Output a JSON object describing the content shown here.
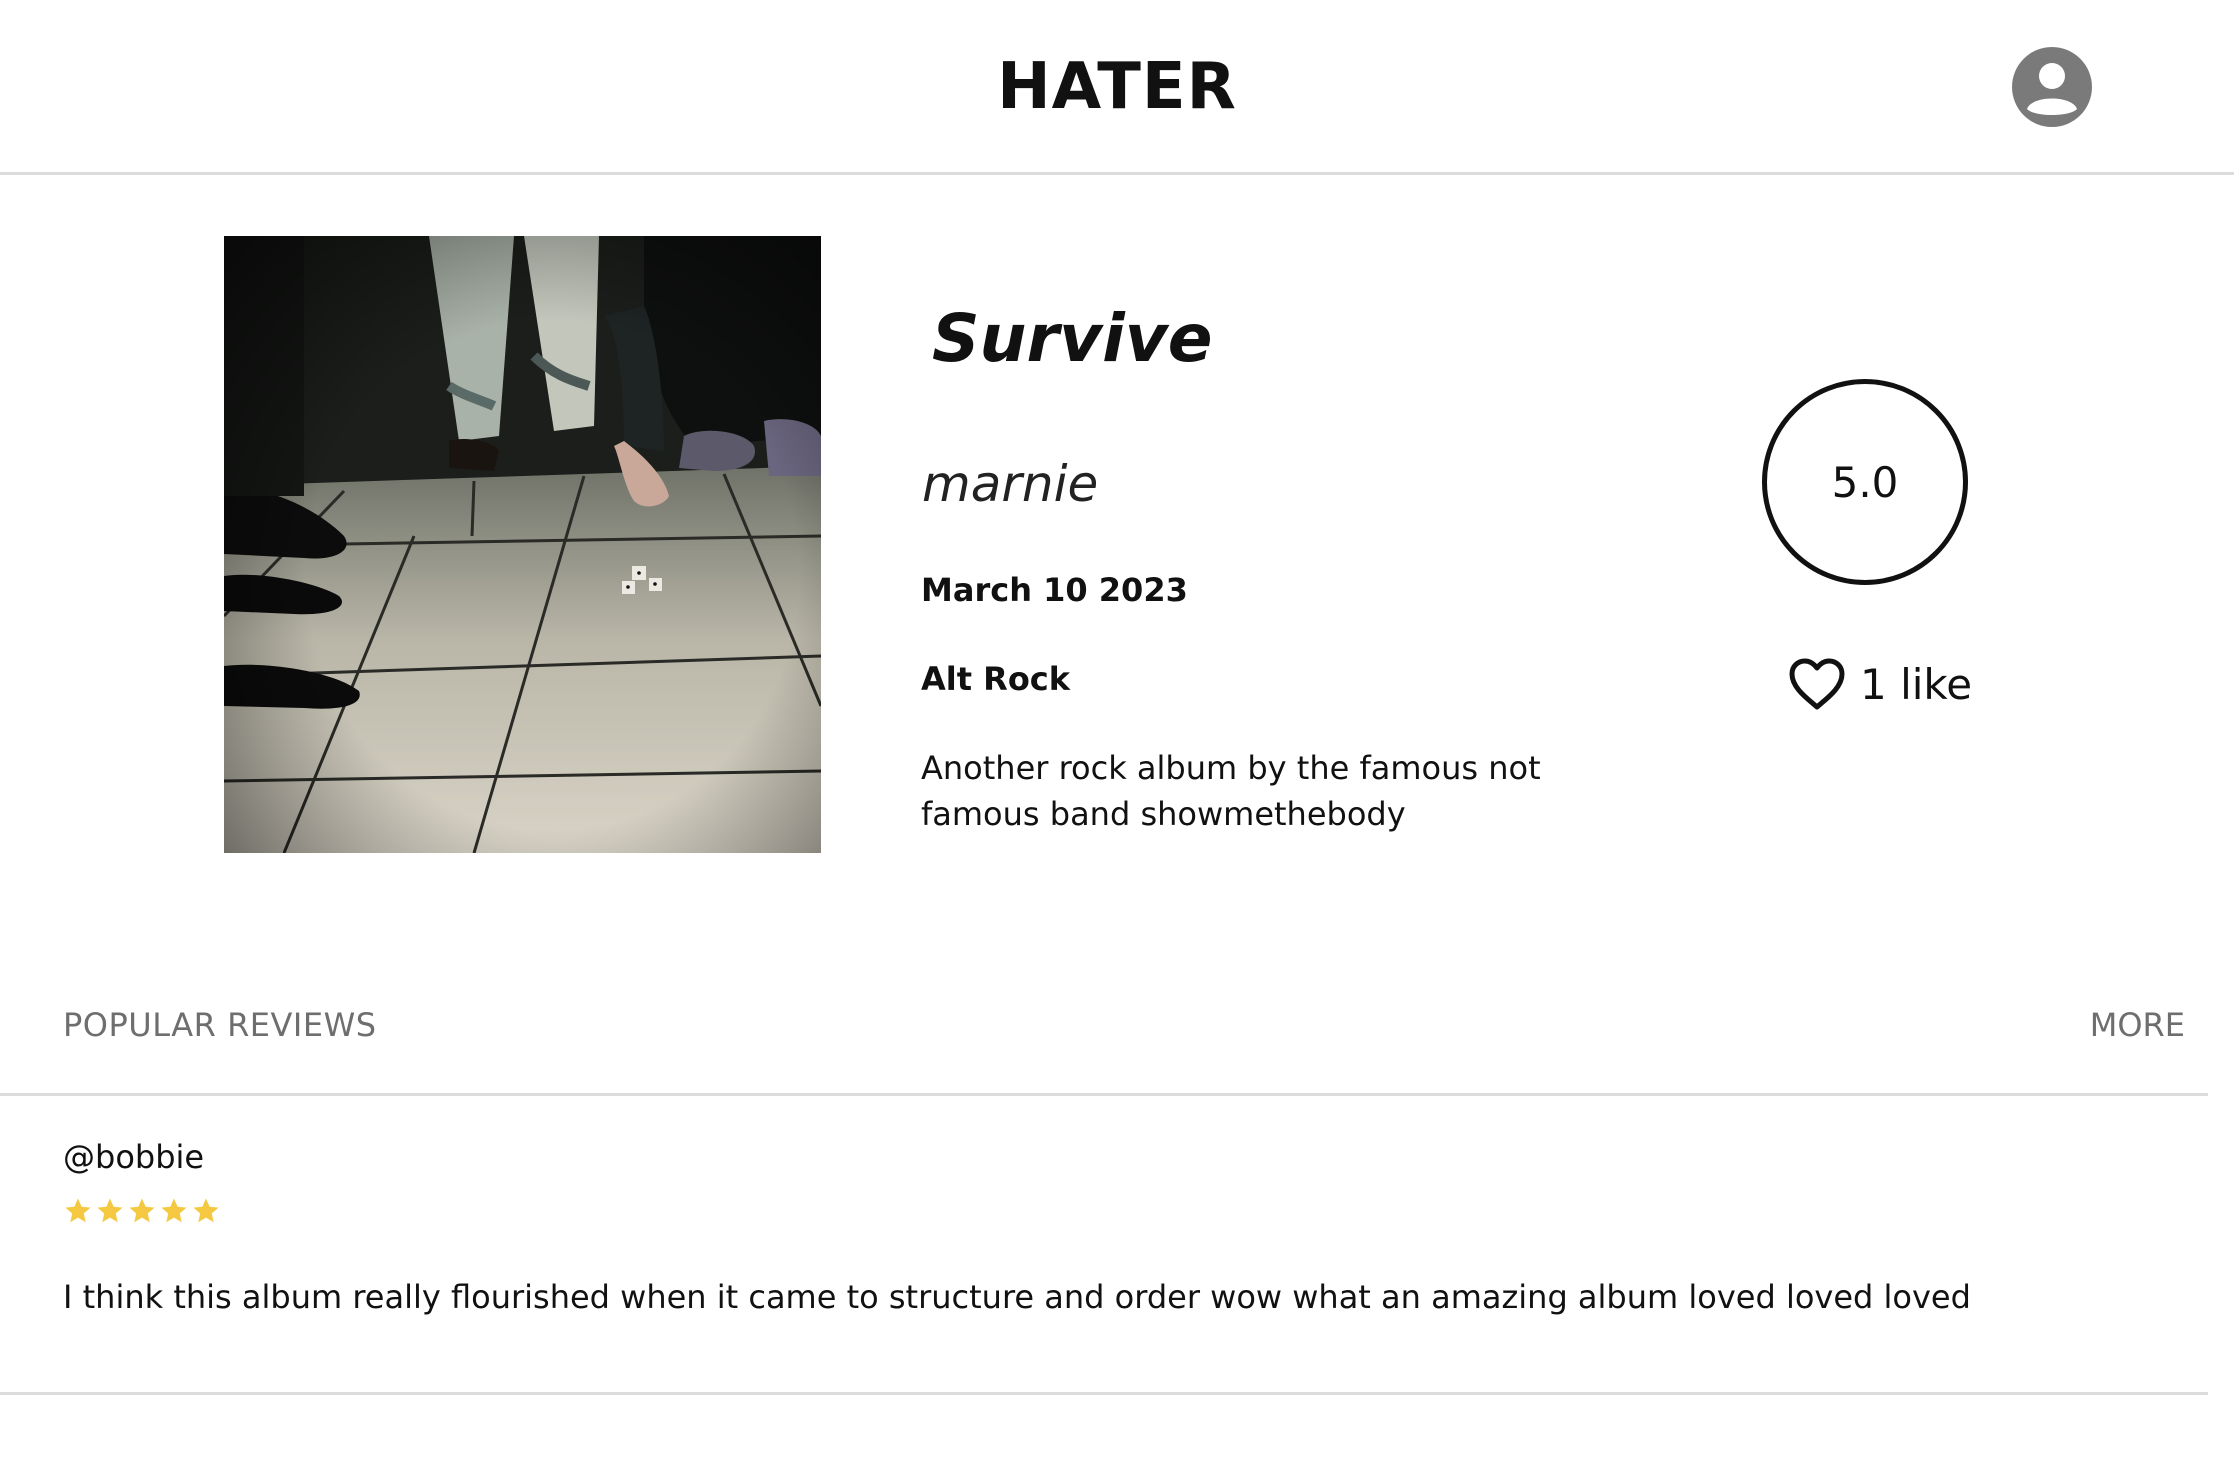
{
  "header": {
    "brand": "HATER",
    "account_icon": "account-circle-icon"
  },
  "album": {
    "title": "Survive",
    "artist": "marnie",
    "date": "March 10 2023",
    "genre": "Alt Rock",
    "description": "Another rock album by the famous not famous band showmethebody",
    "rating": "5.0",
    "likes_label": "1 like",
    "like_icon": "heart-outline-icon"
  },
  "reviews": {
    "title": "POPULAR REVIEWS",
    "more_label": "MORE",
    "items": [
      {
        "user": "@bobbie",
        "stars": 5,
        "star_color": "#f5c842",
        "text": "I think this album really flourished when it came to structure and order wow what an amazing album loved loved loved"
      }
    ]
  }
}
